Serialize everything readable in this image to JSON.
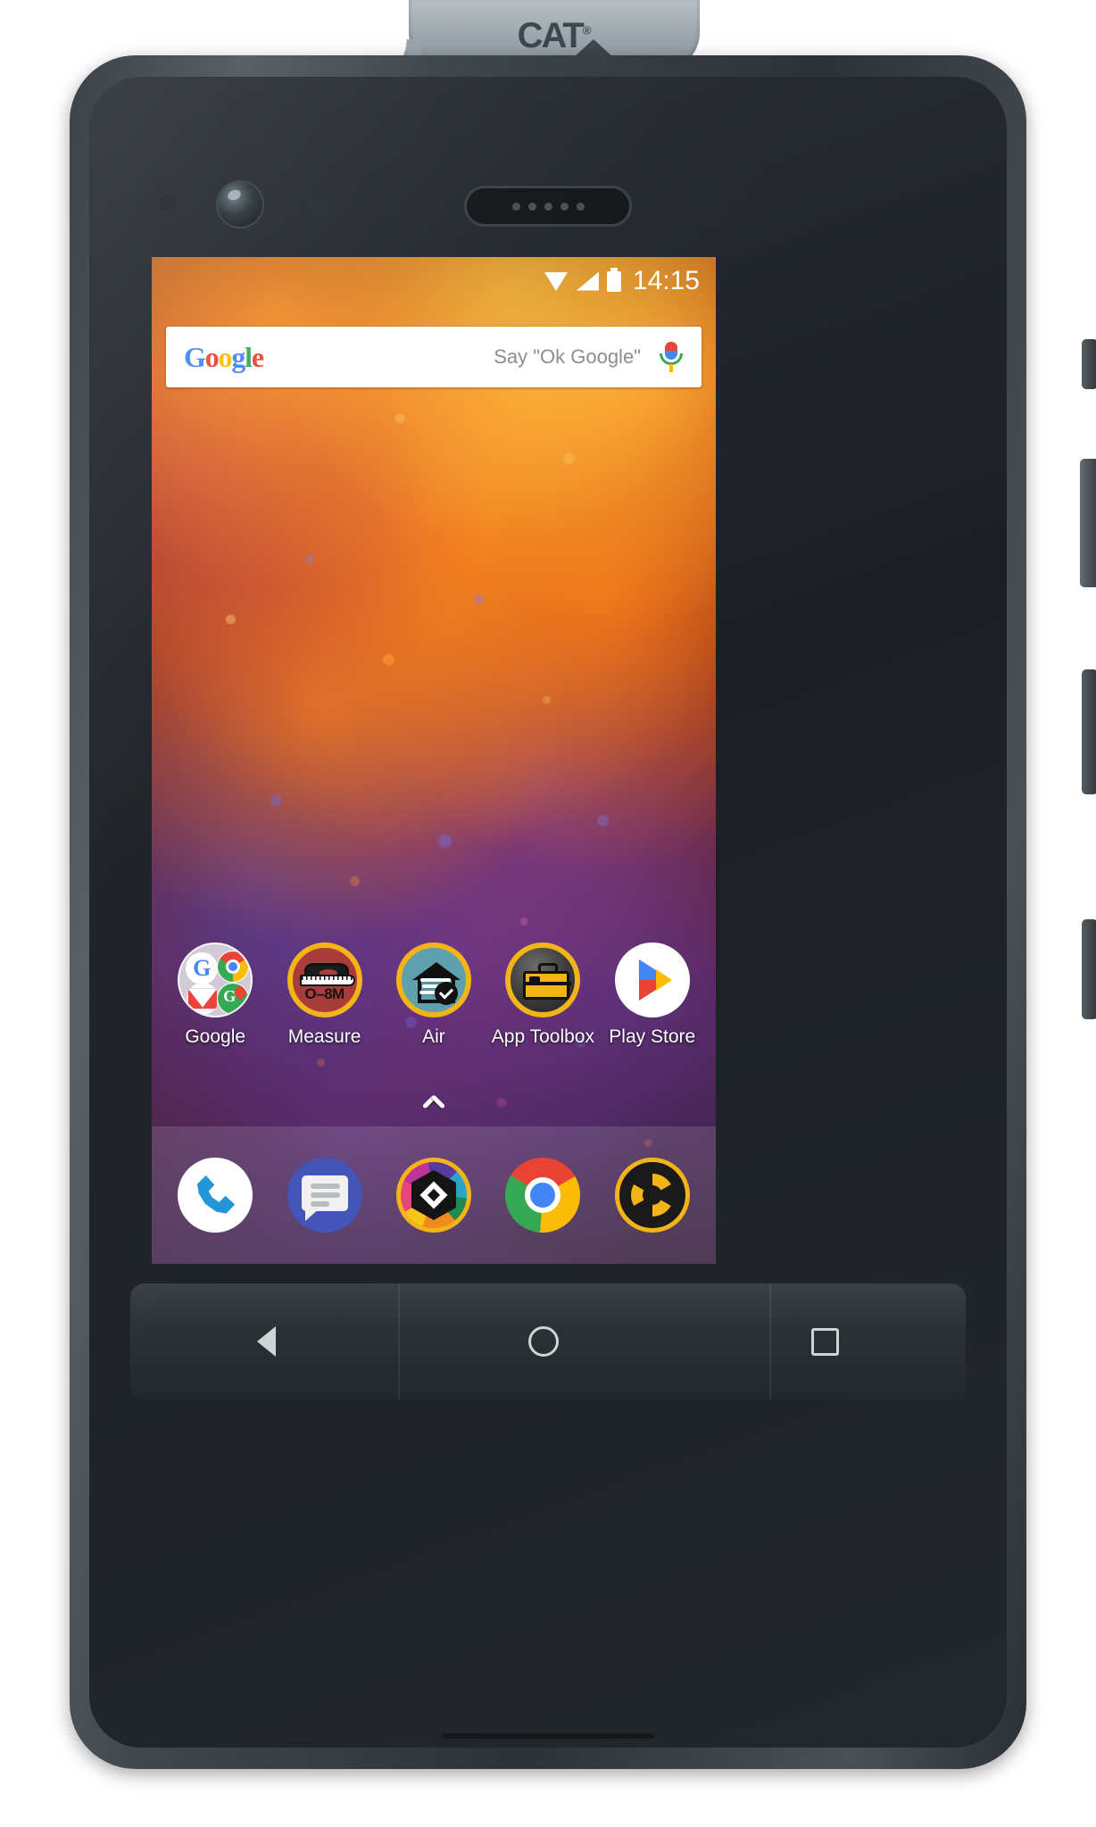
{
  "device": {
    "brand_logo": "CAT",
    "brand_trademark": "®",
    "icons": {
      "front_camera": "front-camera-icon",
      "earpiece": "earpiece-speaker",
      "proximity_sensor": "proximity-sensor",
      "light_sensor": "light-sensor"
    },
    "buttons": {
      "volume": "volume-rocker",
      "power": "power-button",
      "programmable": "programmable-key"
    },
    "colors": {
      "body": "#2c3237",
      "accent_yellow": "#F2B417",
      "bezel": "#1c2024"
    }
  },
  "statusbar": {
    "time": "14:15",
    "icons": [
      "wifi-icon",
      "cell-signal-icon",
      "battery-icon"
    ]
  },
  "search_widget": {
    "logo_letters": [
      {
        "ch": "G",
        "cls": "b"
      },
      {
        "ch": "o",
        "cls": "r"
      },
      {
        "ch": "o",
        "cls": "y"
      },
      {
        "ch": "g",
        "cls": "b"
      },
      {
        "ch": "l",
        "cls": "g"
      },
      {
        "ch": "e",
        "cls": "r"
      }
    ],
    "hint": "Say \"Ok Google\"",
    "mic_icon": "microphone-icon"
  },
  "homescreen": {
    "apps": [
      {
        "label": "Google",
        "icon": "google-folder-icon"
      },
      {
        "label": "Measure",
        "icon": "measure-app-icon",
        "badge_text": "O–8M"
      },
      {
        "label": "Air",
        "icon": "air-quality-app-icon"
      },
      {
        "label": "App Toolbox",
        "icon": "app-toolbox-icon"
      },
      {
        "label": "Play Store",
        "icon": "play-store-icon"
      }
    ],
    "drawer_handle": "app-drawer-chevron-up"
  },
  "dock": {
    "items": [
      {
        "name": "phone-app",
        "icon": "phone-handset-icon"
      },
      {
        "name": "messages-app",
        "icon": "message-bubble-icon"
      },
      {
        "name": "gallery-app",
        "icon": "gallery-hexagon-icon"
      },
      {
        "name": "chrome-app",
        "icon": "chrome-icon"
      },
      {
        "name": "camera-app",
        "icon": "camera-shutter-icon"
      }
    ]
  },
  "navbar": {
    "back": "back-triangle-icon",
    "home": "home-circle-icon",
    "recents": "recents-square-icon"
  }
}
